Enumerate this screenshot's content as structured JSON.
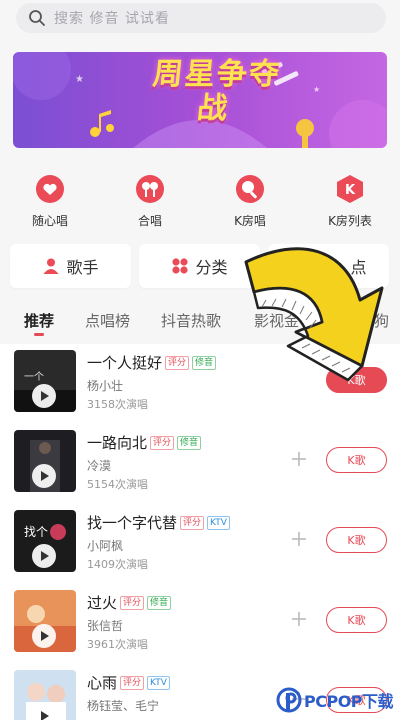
{
  "search": {
    "placeholder": "搜索 修音 试试看"
  },
  "banner": {
    "title": "周星争夺战"
  },
  "quick_actions": [
    {
      "label": "随心唱",
      "icon": "heart-icon"
    },
    {
      "label": "合唱",
      "icon": "duet-mic-icon"
    },
    {
      "label": "K房唱",
      "icon": "mic-icon"
    },
    {
      "label": "K房列表",
      "icon": "k-badge-icon"
    }
  ],
  "categories": [
    {
      "label": "歌手",
      "icon": "person-icon"
    },
    {
      "label": "分类",
      "icon": "grid-icon"
    },
    {
      "label": "点",
      "icon": ""
    }
  ],
  "tabs": [
    {
      "label": "推荐",
      "active": true
    },
    {
      "label": "点唱榜",
      "active": false
    },
    {
      "label": "抖音热歌",
      "active": false
    },
    {
      "label": "影视金",
      "active": false
    },
    {
      "label": "狗",
      "active": false
    }
  ],
  "songs": [
    {
      "title": "一个人挺好",
      "tags": [
        "评分",
        "修音"
      ],
      "artist": "杨小壮",
      "plays": "3158次演唱",
      "button": "K歌",
      "plus": false
    },
    {
      "title": "一路向北",
      "tags": [
        "评分",
        "修音"
      ],
      "artist": "冷漠",
      "plays": "5154次演唱",
      "button": "K歌",
      "plus": true
    },
    {
      "title": "找一个字代替",
      "tags": [
        "评分",
        "KTV"
      ],
      "artist": "小阿枫",
      "plays": "1409次演唱",
      "button": "K歌",
      "plus": true
    },
    {
      "title": "过火",
      "tags": [
        "评分",
        "修音"
      ],
      "artist": "张信哲",
      "plays": "3961次演唱",
      "button": "K歌",
      "plus": true
    },
    {
      "title": "心雨",
      "tags": [
        "评分",
        "KTV"
      ],
      "artist": "杨钰莹、毛宁",
      "plays": "",
      "button": "K歌",
      "plus": true
    }
  ],
  "watermark": {
    "text": "PCPOP下载"
  },
  "colors": {
    "accent": "#e64a55",
    "tag_green": "#34a853",
    "tag_blue": "#2c8fde",
    "arrow_yellow": "#f4d11c"
  }
}
